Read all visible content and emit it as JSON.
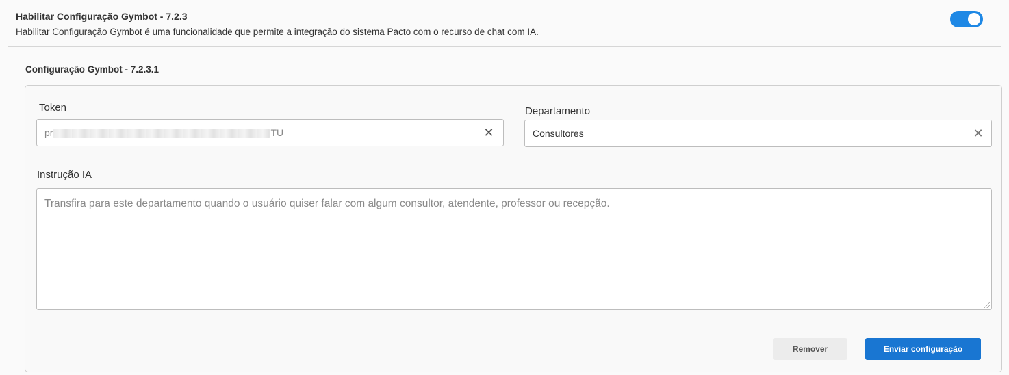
{
  "header": {
    "title": "Habilitar Configuração Gymbot - 7.2.3",
    "description": "Habilitar Configuração Gymbot é uma funcionalidade que permite a integração do sistema Pacto com o recurso de chat com IA.",
    "toggle_enabled": true
  },
  "config": {
    "title": "Configuração Gymbot - 7.2.3.1",
    "token": {
      "label": "Token",
      "value_start": "pr",
      "value_end": "TU",
      "clear_icon": "close-icon"
    },
    "departamento": {
      "label": "Departamento",
      "value": "Consultores",
      "clear_icon": "close-icon"
    },
    "instrucao": {
      "label": "Instrução IA",
      "placeholder": "Transfira para este departamento quando o usuário quiser falar com algum consultor, atendente, professor ou recepção."
    },
    "actions": {
      "remove_label": "Remover",
      "send_label": "Enviar configuração"
    }
  },
  "colors": {
    "accent": "#1976d2",
    "toggle": "#1e88e5",
    "background": "#fafafa"
  }
}
